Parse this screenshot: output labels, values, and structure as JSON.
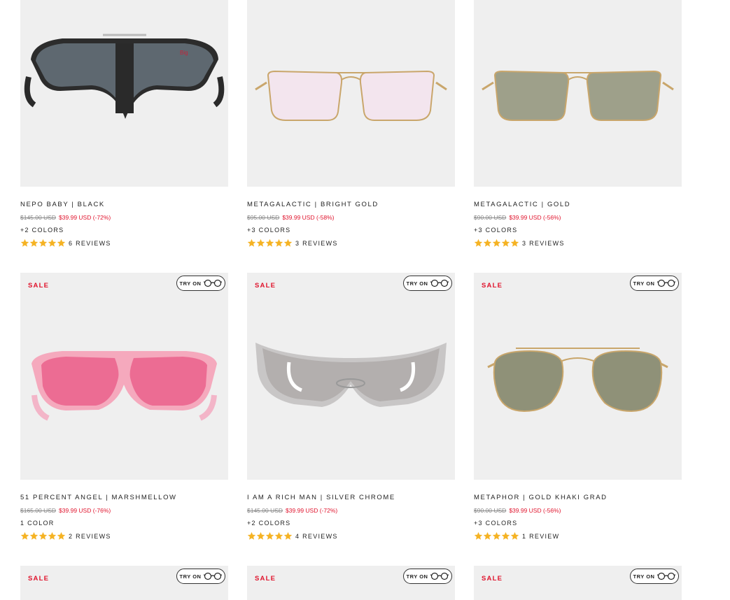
{
  "try_on_label": "TRY ON",
  "sale_label": "SALE",
  "accent_color": "#e0142d",
  "star_color": "#f5b324",
  "products": [
    {
      "name": "NEPO BABY | BLACK",
      "old_price": "$145.00 USD",
      "new_price": "$39.99 USD (-72%)",
      "colors": "+2 COLORS",
      "reviews": "6 REVIEWS",
      "rating": 5,
      "sale": false,
      "try_on": false,
      "style": "shield-black"
    },
    {
      "name": "METAGALACTIC | BRIGHT GOLD",
      "old_price": "$95.00 USD",
      "new_price": "$39.99 USD (-58%)",
      "colors": "+3 COLORS",
      "reviews": "3 REVIEWS",
      "rating": 5,
      "sale": false,
      "try_on": false,
      "style": "rect-pink"
    },
    {
      "name": "METAGALACTIC | GOLD",
      "old_price": "$90.00 USD",
      "new_price": "$39.99 USD (-56%)",
      "colors": "+3 COLORS",
      "reviews": "3 REVIEWS",
      "rating": 5,
      "sale": false,
      "try_on": false,
      "style": "rect-green"
    },
    {
      "name": "51 PERCENT ANGEL | MARSHMELLOW",
      "old_price": "$165.00 USD",
      "new_price": "$39.99 USD (-76%)",
      "colors": "1 COLOR",
      "reviews": "2 REVIEWS",
      "rating": 5,
      "sale": true,
      "try_on": true,
      "style": "wrap-pink"
    },
    {
      "name": "I AM A RICH MAN | SILVER CHROME",
      "old_price": "$145.00 USD",
      "new_price": "$39.99 USD (-72%)",
      "colors": "+2 COLORS",
      "reviews": "4 REVIEWS",
      "rating": 5,
      "sale": true,
      "try_on": true,
      "style": "shield-silver"
    },
    {
      "name": "METAPHOR | GOLD KHAKI GRAD",
      "old_price": "$90.00 USD",
      "new_price": "$39.99 USD (-56%)",
      "colors": "+3 COLORS",
      "reviews": "1 REVIEW",
      "rating": 5,
      "sale": true,
      "try_on": true,
      "style": "aviator-green"
    },
    {
      "name": "",
      "old_price": "",
      "new_price": "",
      "colors": "",
      "reviews": "",
      "rating": 0,
      "sale": true,
      "try_on": true,
      "style": "none"
    },
    {
      "name": "",
      "old_price": "",
      "new_price": "",
      "colors": "",
      "reviews": "",
      "rating": 0,
      "sale": true,
      "try_on": true,
      "style": "none"
    },
    {
      "name": "",
      "old_price": "",
      "new_price": "",
      "colors": "",
      "reviews": "",
      "rating": 0,
      "sale": true,
      "try_on": true,
      "style": "none"
    }
  ]
}
